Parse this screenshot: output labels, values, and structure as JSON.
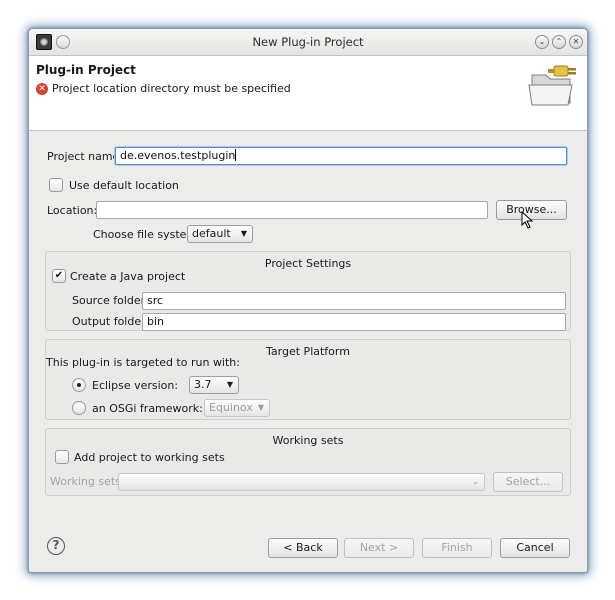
{
  "window": {
    "title": "New Plug-in Project"
  },
  "header": {
    "title": "Plug-in Project",
    "error_message": "Project location directory must be specified"
  },
  "project_name": {
    "label": "Project name:",
    "value": "de.evenos.testplugin"
  },
  "use_default_location": {
    "label": "Use default location",
    "checked": false
  },
  "location": {
    "label": "Location:",
    "value": "",
    "browse_label": "Browse..."
  },
  "file_system": {
    "label": "Choose file system:",
    "value": "default"
  },
  "project_settings": {
    "title": "Project Settings",
    "create_java_label": "Create a Java project",
    "create_java_checked": true,
    "source_folder_label": "Source folder:",
    "source_folder_value": "src",
    "output_folder_label": "Output folder:",
    "output_folder_value": "bin"
  },
  "target_platform": {
    "title": "Target Platform",
    "intro": "This plug-in is targeted to run with:",
    "eclipse_label": "Eclipse version:",
    "eclipse_value": "3.7",
    "osgi_label": "an OSGi framework:",
    "osgi_value": "Equinox",
    "selected": "eclipse"
  },
  "working_sets": {
    "title": "Working sets",
    "add_label": "Add project to working sets",
    "add_checked": false,
    "sets_label": "Working sets:",
    "sets_value": "",
    "select_label": "Select..."
  },
  "footer": {
    "back_label": "< Back",
    "next_label": "Next >",
    "finish_label": "Finish",
    "cancel_label": "Cancel"
  }
}
